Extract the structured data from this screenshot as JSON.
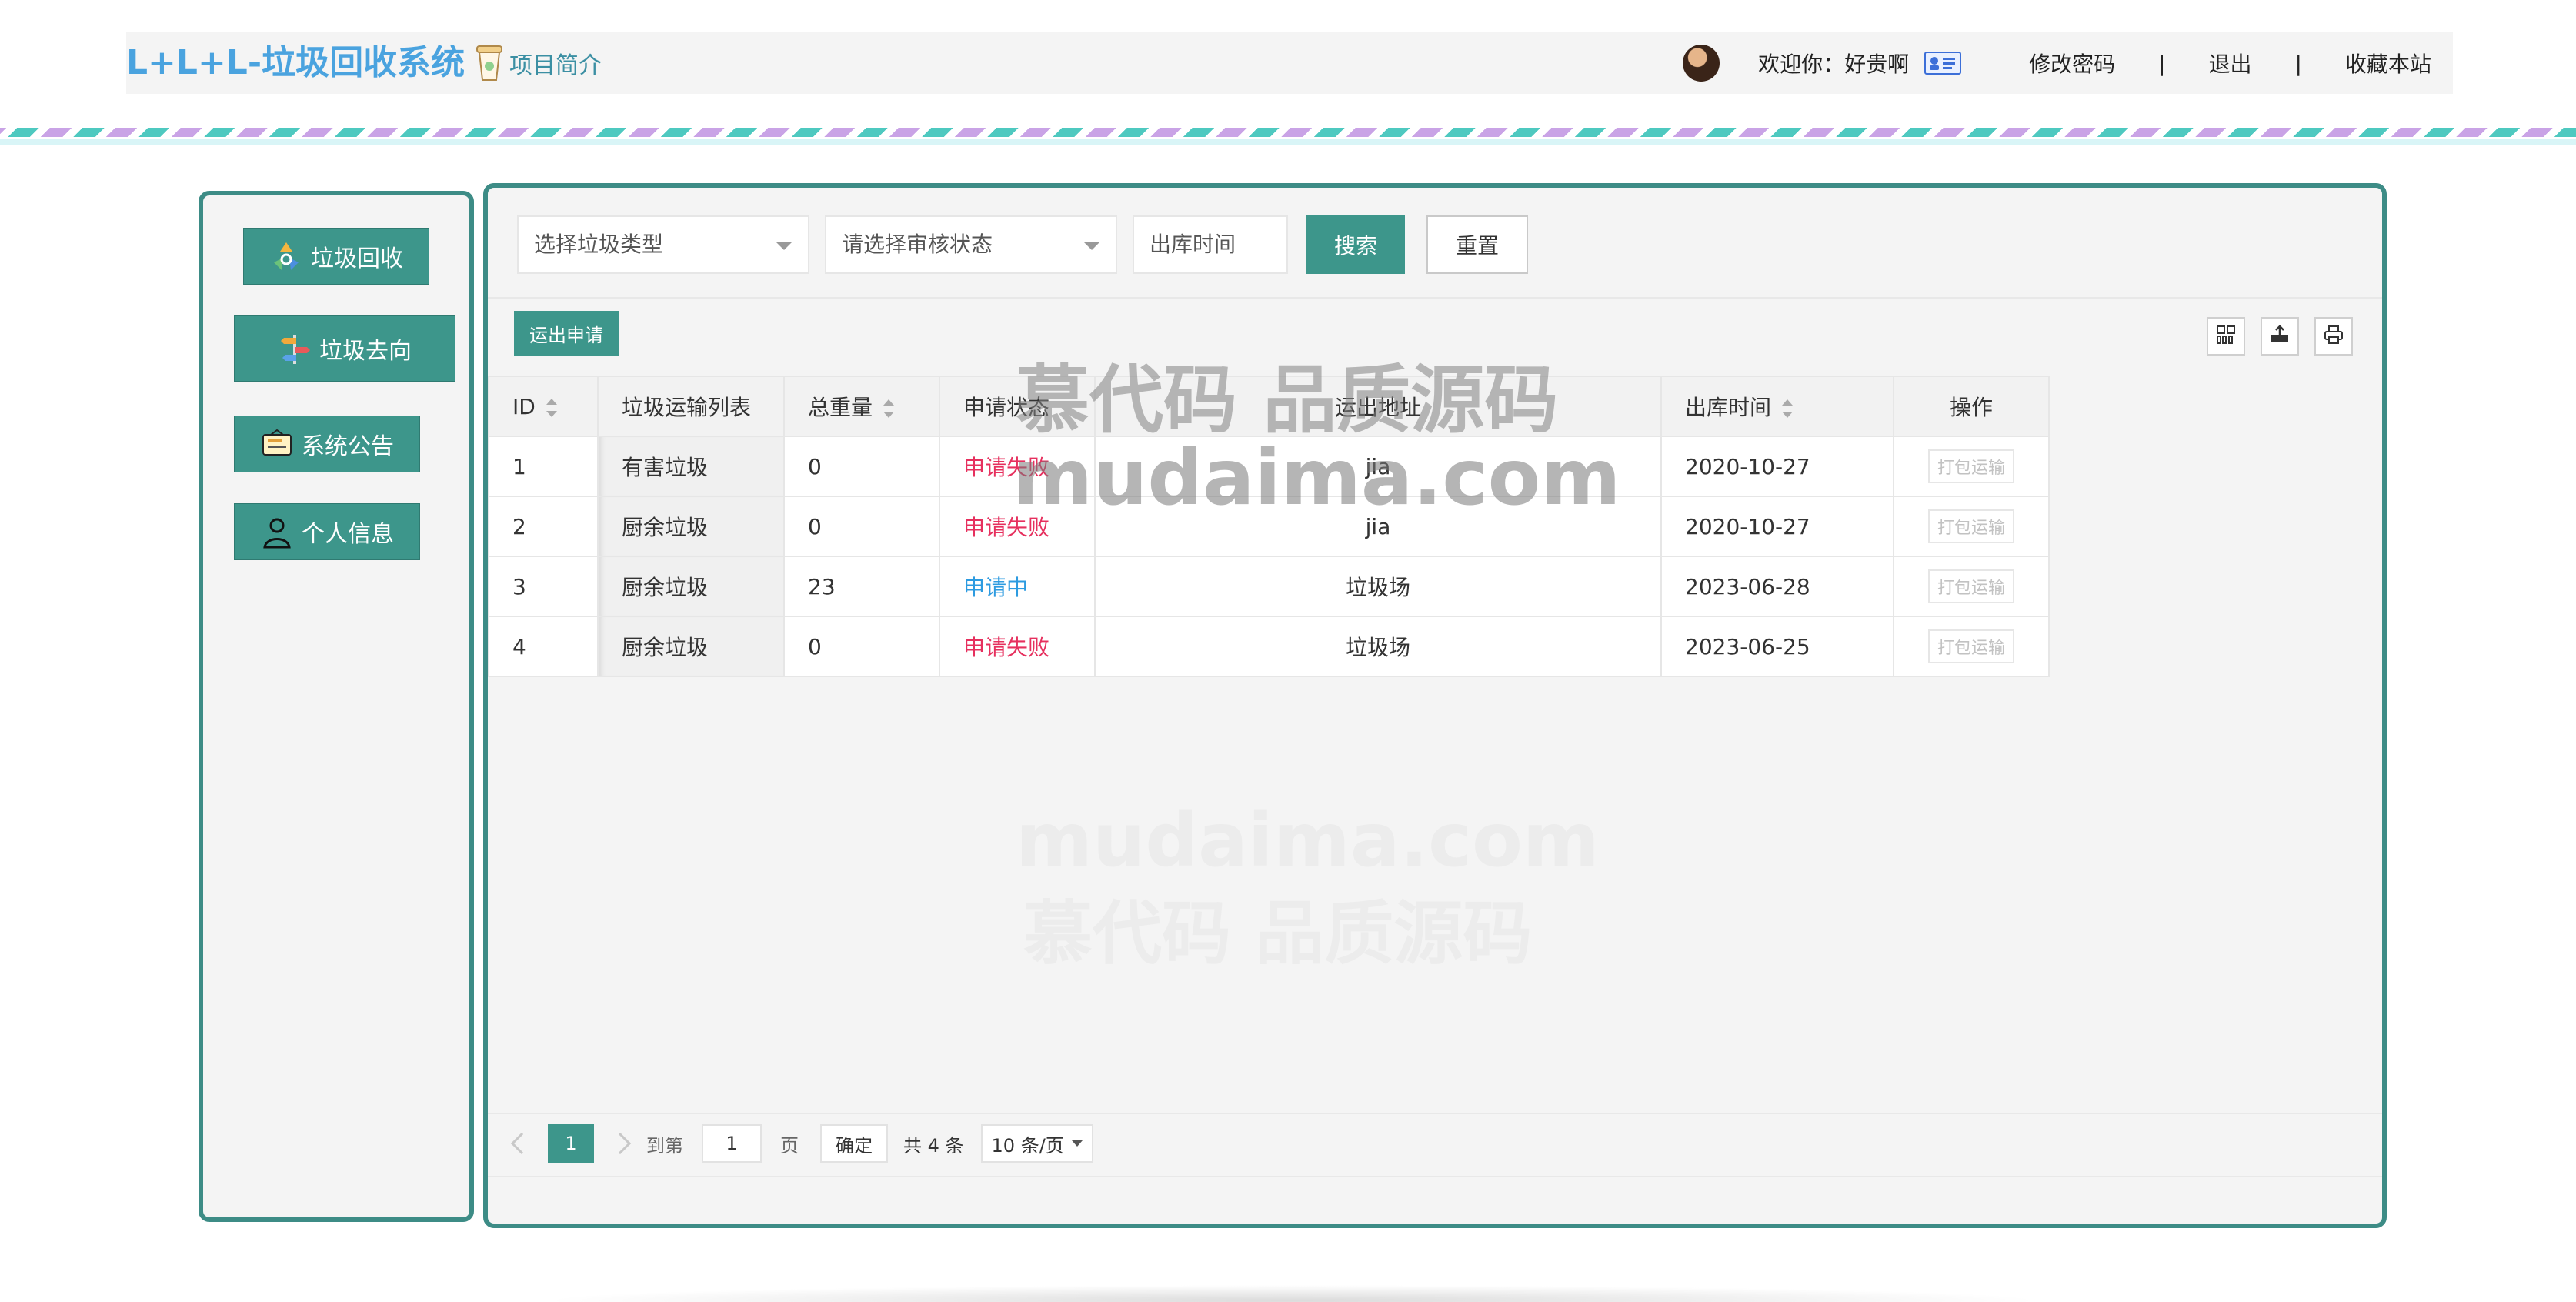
{
  "header": {
    "brand": "L+L+L-垃圾回收系统",
    "intro_link": "项目简介",
    "welcome": "欢迎你：好贵啊",
    "nav": [
      "修改密码",
      "|",
      "退出",
      "|",
      "收藏本站"
    ]
  },
  "sidebar": {
    "items": [
      {
        "label": "垃圾回收",
        "icon": "recycle-icon"
      },
      {
        "label": "垃圾去向",
        "icon": "signpost-icon"
      },
      {
        "label": "系统公告",
        "icon": "announcement-icon"
      },
      {
        "label": "个人信息",
        "icon": "user-icon"
      }
    ]
  },
  "filters": {
    "type_placeholder": "选择垃圾类型",
    "status_placeholder": "请选择审核状态",
    "date_placeholder": "出库时间",
    "search_label": "搜索",
    "reset_label": "重置"
  },
  "toolbar": {
    "apply_label": "运出申请"
  },
  "table": {
    "headers": [
      "ID",
      "垃圾运输列表",
      "总重量",
      "申请状态",
      "运出地址",
      "出库时间",
      "操作"
    ],
    "rows": [
      {
        "id": "1",
        "name": "有害垃圾",
        "weight": "0",
        "status": "申请失败",
        "address": "jia",
        "date": "2020-10-27",
        "op": "打包运输"
      },
      {
        "id": "2",
        "name": "厨余垃圾",
        "weight": "0",
        "status": "申请失败",
        "address": "jia",
        "date": "2020-10-27",
        "op": "打包运输"
      },
      {
        "id": "3",
        "name": "厨余垃圾",
        "weight": "23",
        "status": "申请中",
        "address": "垃圾场",
        "date": "2023-06-28",
        "op": "打包运输"
      },
      {
        "id": "4",
        "name": "厨余垃圾",
        "weight": "0",
        "status": "申请失败",
        "address": "垃圾场",
        "date": "2023-06-25",
        "op": "打包运输"
      }
    ]
  },
  "pager": {
    "current": "1",
    "goto_label": "到第",
    "page_input": "1",
    "page_unit": "页",
    "confirm_label": "确定",
    "total": "共 4 条",
    "page_size": "10 条/页"
  },
  "watermark": {
    "line1": "慕代码 品质源码",
    "line2": "mudaima.com"
  },
  "colors": {
    "accent": "#3d968b",
    "brand": "#4aa3df",
    "fail": "#e6305e",
    "pending": "#2d9be0"
  }
}
